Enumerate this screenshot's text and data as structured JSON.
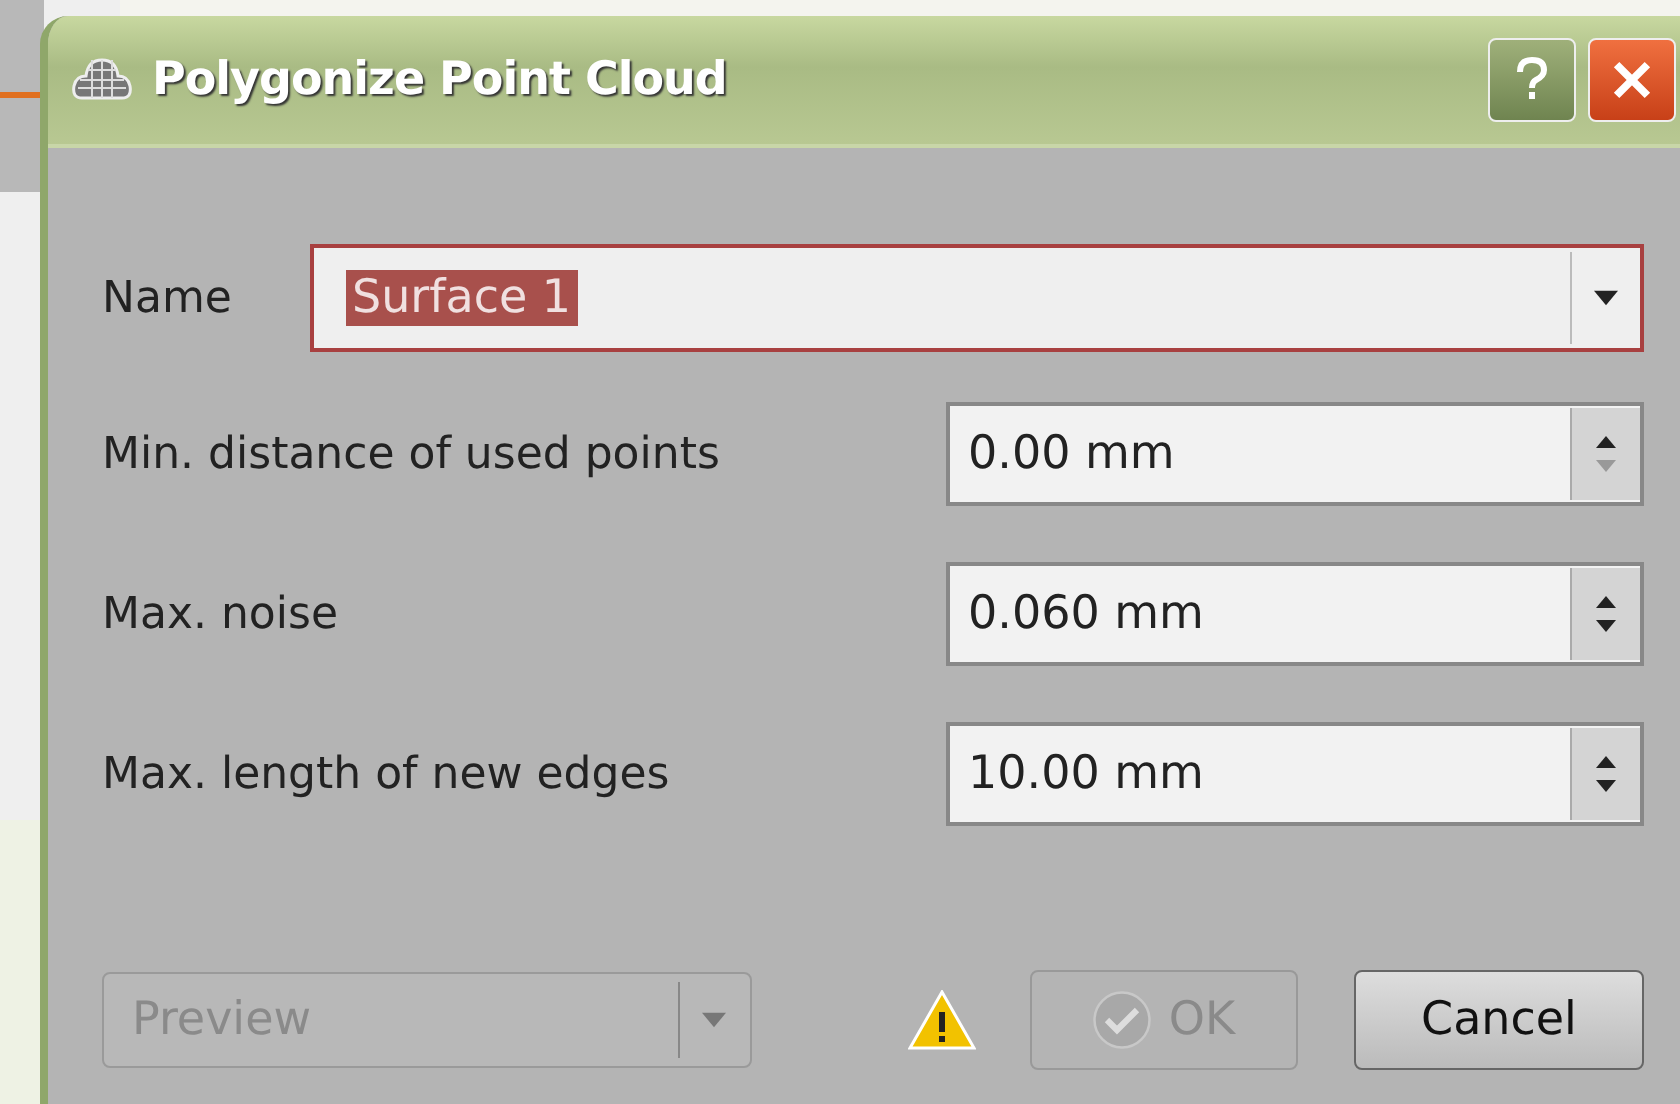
{
  "window": {
    "title": "Polygonize Point Cloud"
  },
  "name_field": {
    "label": "Name",
    "value": "Surface 1",
    "text_selected": true
  },
  "parameters": [
    {
      "label": "Min. distance of used points",
      "value": "0.00 mm",
      "down_disabled": true
    },
    {
      "label": "Max. noise",
      "value": "0.060 mm",
      "down_disabled": false
    },
    {
      "label": "Max. length of new edges",
      "value": "10.00 mm",
      "down_disabled": false
    }
  ],
  "preview": {
    "label": "Preview",
    "disabled": true
  },
  "warning": true,
  "buttons": [
    {
      "label": "OK",
      "kind": "ok",
      "disabled": true
    },
    {
      "label": "Cancel",
      "kind": "cancel",
      "disabled": false
    }
  ]
}
